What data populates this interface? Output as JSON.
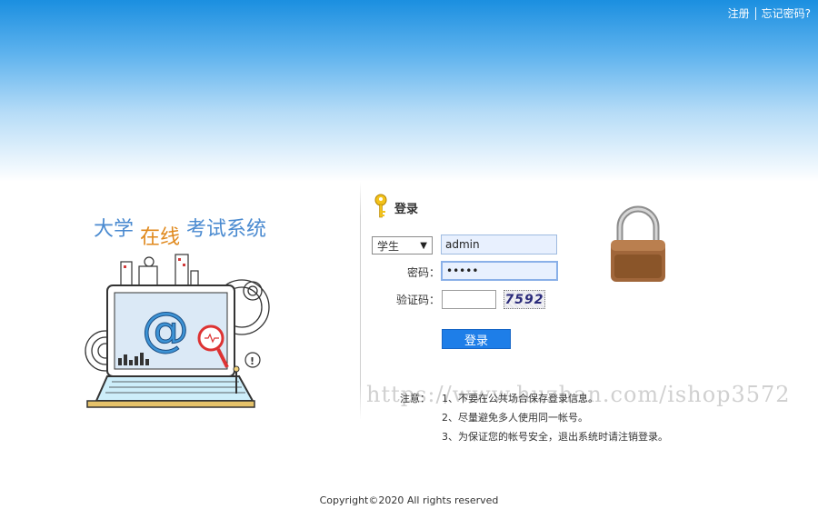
{
  "header": {
    "register_label": "注册",
    "forgot_label": "忘记密码?"
  },
  "branding": {
    "title_part1": "大学",
    "title_part2": "在线",
    "title_part3": "考试系统"
  },
  "login": {
    "heading": "登录",
    "role_value": "学生",
    "username_value": "admin",
    "password_label": "密码：",
    "password_value": "•••••",
    "captcha_label": "验证码：",
    "captcha_value": "",
    "captcha_image_text": "7592",
    "submit_label": "登录"
  },
  "notice": {
    "title": "注意：",
    "items": [
      {
        "num": "1、",
        "text": "不要在公共场合保存登录信息。"
      },
      {
        "num": "2、",
        "text": "尽量避免多人使用同一帐号。"
      },
      {
        "num": "3、",
        "text": "为保证您的帐号安全，退出系统时请注销登录。"
      }
    ]
  },
  "watermark": "https://www.huzhan.com/ishop3572",
  "footer": "Copyright©2020 All rights reserved",
  "colors": {
    "accent": "#1e7ee8",
    "hero_top": "#1b8fe0",
    "title_blue": "#4a8ad0",
    "title_orange": "#e0891d"
  }
}
